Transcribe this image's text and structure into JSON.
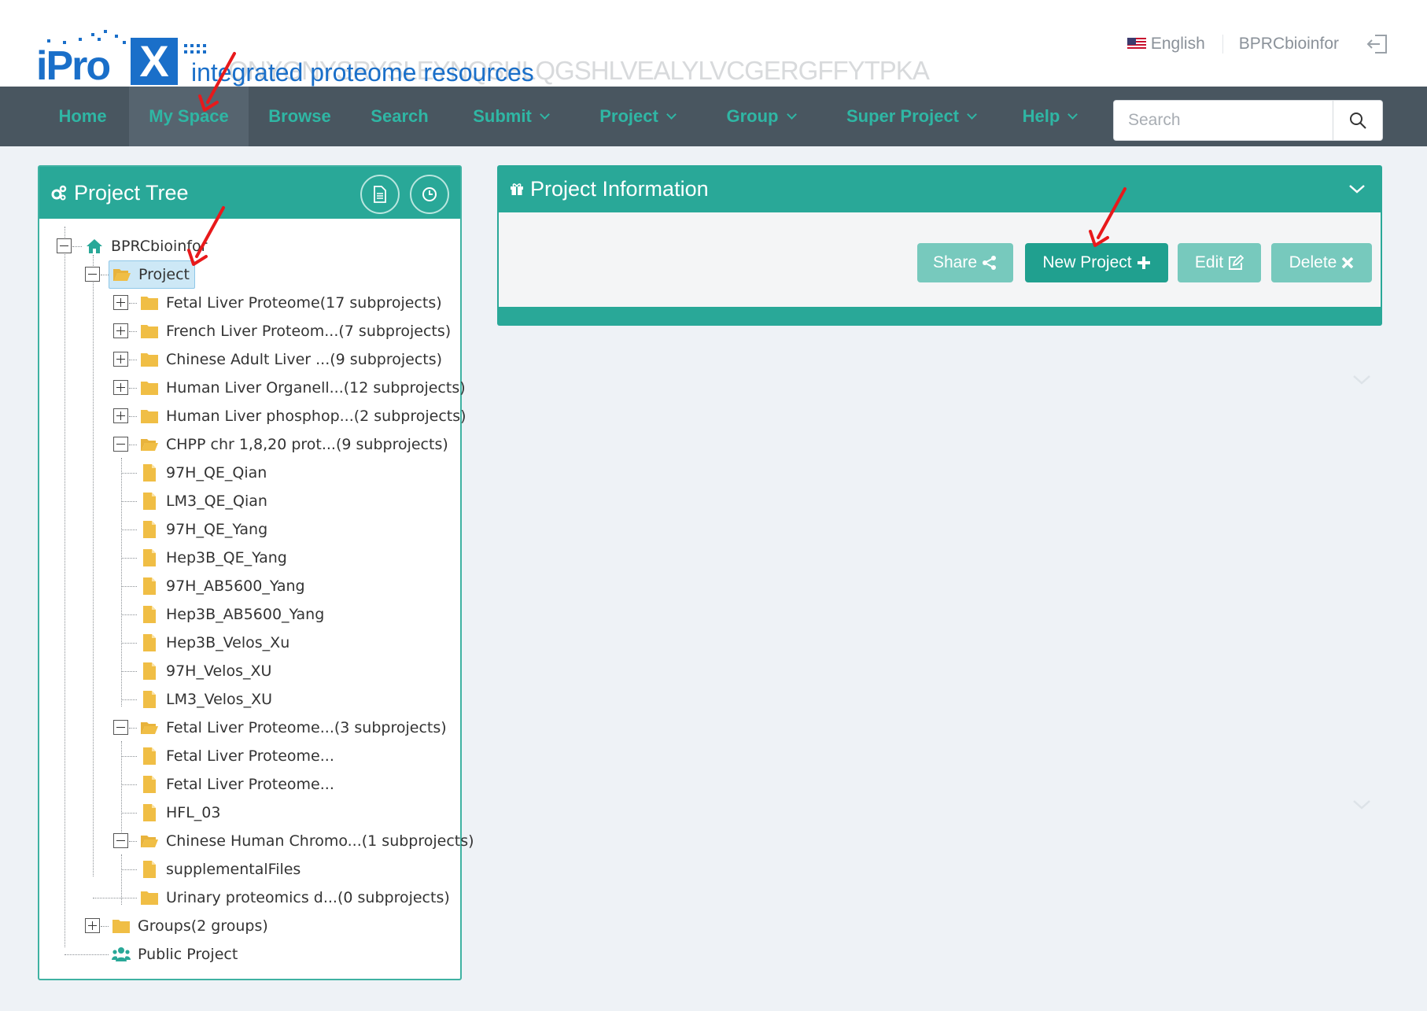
{
  "header": {
    "logo_text": "iPro",
    "logo_x": "X",
    "tagline": "integrated proteome resources",
    "watermark": "QNYGNYSRYSLEYNQSHLQGSHLVEALYLVCGERGFFYTPKA",
    "language": "English",
    "username": "BPRCbioinfor",
    "logout_icon": "logout-icon"
  },
  "nav": {
    "items": [
      {
        "label": "Home",
        "dropdown": false,
        "active": false
      },
      {
        "label": "My Space",
        "dropdown": false,
        "active": true
      },
      {
        "label": "Browse",
        "dropdown": false,
        "active": false
      },
      {
        "label": "Search",
        "dropdown": false,
        "active": false
      },
      {
        "label": "Submit",
        "dropdown": true,
        "active": false
      },
      {
        "label": "Project",
        "dropdown": true,
        "active": false
      },
      {
        "label": "Group",
        "dropdown": true,
        "active": false
      },
      {
        "label": "Super Project",
        "dropdown": true,
        "active": false
      },
      {
        "label": "Help",
        "dropdown": true,
        "active": false
      }
    ],
    "search": {
      "placeholder": "Search",
      "value": ""
    }
  },
  "tree_panel": {
    "title": "Project Tree",
    "title_icon": "gears-icon",
    "header_buttons": [
      "document-icon",
      "clock-icon"
    ],
    "root": "BPRCbioinfor",
    "project_folder": "Project",
    "projects": [
      {
        "label": "Fetal Liver Proteome(17 subprojects)",
        "expanded": false
      },
      {
        "label": "French Liver Proteom...(7 subprojects)",
        "expanded": false
      },
      {
        "label": "Chinese Adult Liver ...(9 subprojects)",
        "expanded": false
      },
      {
        "label": "Human Liver Organell...(12 subprojects)",
        "expanded": false
      },
      {
        "label": "Human Liver phosphop...(2 subprojects)",
        "expanded": false
      },
      {
        "label": "CHPP chr 1,8,20 prot...(9 subprojects)",
        "expanded": true,
        "children": [
          "97H_QE_Qian",
          "LM3_QE_Qian",
          "97H_QE_Yang",
          "Hep3B_QE_Yang",
          "97H_AB5600_Yang",
          "Hep3B_AB5600_Yang",
          "Hep3B_Velos_Xu",
          "97H_Velos_XU",
          "LM3_Velos_XU"
        ]
      },
      {
        "label": "Fetal Liver Proteome...(3 subprojects)",
        "expanded": true,
        "children": [
          "Fetal Liver Proteome...",
          "Fetal Liver Proteome...",
          "HFL_03"
        ]
      },
      {
        "label": "Chinese Human Chromo...(1 subprojects)",
        "expanded": true,
        "children": [
          "supplementalFiles"
        ]
      },
      {
        "label": "Urinary proteomics d...(0 subprojects)",
        "expanded": false,
        "leaf": true
      }
    ],
    "groups": "Groups(2 groups)",
    "public_project": "Public Project"
  },
  "info_panel": {
    "title": "Project Information",
    "title_icon": "gift-icon",
    "buttons": [
      {
        "label": "Share",
        "icon": "share-icon"
      },
      {
        "label": "New Project",
        "icon": "plus-icon"
      },
      {
        "label": "Edit",
        "icon": "edit-icon"
      },
      {
        "label": "Delete",
        "icon": "close-icon"
      }
    ]
  },
  "colors": {
    "teal": "#29a898",
    "teal_light": "#77c9bd",
    "nav_bg": "#495660",
    "nav_text": "#2fb6a4",
    "logo_blue": "#1a6fc9",
    "folder": "#f0be45",
    "annotation_arrow": "#e8191b"
  }
}
